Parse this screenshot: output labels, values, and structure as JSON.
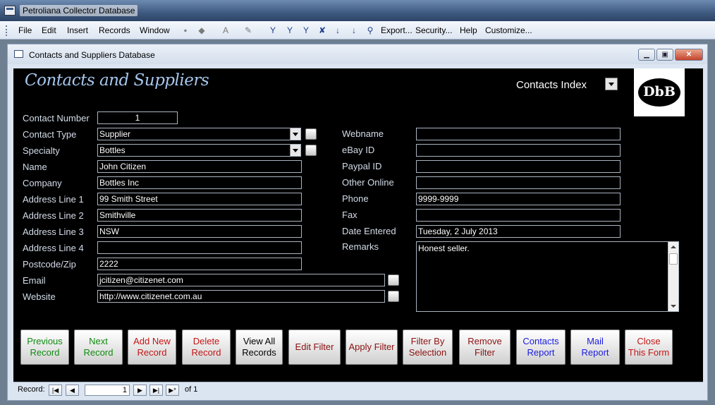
{
  "app": {
    "title": "Petroliana Collector Database"
  },
  "menu": [
    "File",
    "Edit",
    "Insert",
    "Records",
    "Window",
    "Export...",
    "Security...",
    "Help",
    "Customize..."
  ],
  "subwindow": {
    "title": "Contacts and Suppliers Database"
  },
  "form": {
    "title": "Contacts and Suppliers",
    "index_label": "Contacts Index",
    "logo_text": "DbB"
  },
  "labels": {
    "contact_number": "Contact Number",
    "contact_type": "Contact Type",
    "specialty": "Specialty",
    "name": "Name",
    "company": "Company",
    "address1": "Address Line 1",
    "address2": "Address Line 2",
    "address3": "Address Line 3",
    "address4": "Address Line 4",
    "postcode": "Postcode/Zip",
    "email": "Email",
    "website": "Website",
    "webname": "Webname",
    "ebay": "eBay ID",
    "paypal": "Paypal ID",
    "other_online": "Other Online",
    "phone": "Phone",
    "fax": "Fax",
    "date_entered": "Date Entered",
    "remarks": "Remarks"
  },
  "values": {
    "contact_number": "1",
    "contact_type": "Supplier",
    "specialty": "Bottles",
    "name": "John Citizen",
    "company": "Bottles Inc",
    "address1": "99 Smith Street",
    "address2": "Smithville",
    "address3": "NSW",
    "address4": "",
    "postcode": "2222",
    "email": "jcitizen@citizenet.com",
    "website": "http://www.citizenet.com.au",
    "webname": "",
    "ebay": "",
    "paypal": "",
    "other_online": "",
    "phone": "9999-9999",
    "fax": "",
    "date_entered": "Tuesday, 2 July 2013",
    "remarks": "Honest seller."
  },
  "buttons": [
    {
      "l1": "Previous",
      "l2": "Record"
    },
    {
      "l1": "Next",
      "l2": "Record"
    },
    {
      "l1": "Add New",
      "l2": "Record"
    },
    {
      "l1": "Delete",
      "l2": "Record"
    },
    {
      "l1": "View All",
      "l2": "Records"
    },
    {
      "l1": "Edit Filter",
      "l2": ""
    },
    {
      "l1": "Apply Filter",
      "l2": ""
    },
    {
      "l1": "Filter By",
      "l2": "Selection"
    },
    {
      "l1": "Remove",
      "l2": "Filter"
    },
    {
      "l1": "Contacts",
      "l2": "Report"
    },
    {
      "l1": "Mail",
      "l2": "Report"
    },
    {
      "l1": "Close",
      "l2": "This Form"
    }
  ],
  "record_nav": {
    "label": "Record:",
    "current": "1",
    "of_text": "of  1"
  },
  "colors": {
    "form_bg": "#000000",
    "title": "#a7c7ee",
    "label": "#d3dde9"
  }
}
